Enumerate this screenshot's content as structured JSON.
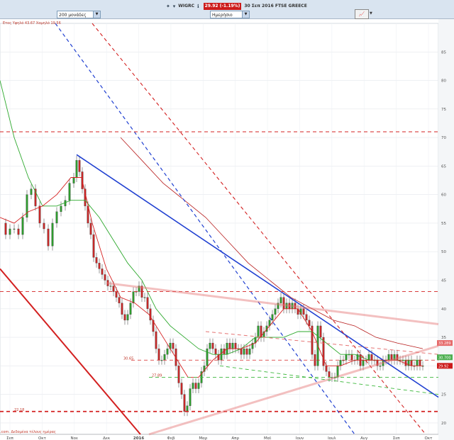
{
  "toolbar": {
    "period_selected": "200 μονάδες",
    "interval_selected": "Ημερήσιο",
    "ticker": "WIGRC",
    "price": "29.92 (-1.19%)",
    "chart_title": "30 Σεπ 2016 FTSE GREECE",
    "icons": [
      "info-icon",
      "chart-type-icon"
    ]
  },
  "annotations": {
    "hilo": "Ετος Υψηλό 43.67 Χαμηλό 19.56",
    "footnote": ".com. Δεδομένα τέλους ημέρας",
    "level_a": "30.65",
    "level_b": "27.89",
    "level_c": "22.18",
    "value_a": "33.289",
    "value_b": "30.700",
    "value_c": "29.92"
  },
  "chart_data": {
    "type": "candlestick",
    "title": "30 Σεπ 2016 FTSE GREECE",
    "ylim": [
      18,
      90
    ],
    "yticks": [
      20,
      25,
      30,
      35,
      40,
      45,
      50,
      55,
      60,
      65,
      70,
      75,
      80,
      85
    ],
    "xticks": [
      "Σεπ",
      "Οκτ",
      "Νοε",
      "Δεκ",
      "2016",
      "Φεβ",
      "Μαρ",
      "Απρ",
      "Μαϊ",
      "Ιουν",
      "Ιουλ",
      "Αυγ",
      "Σεπ",
      "Οκτ"
    ],
    "grid": true,
    "price_path": [
      [
        0,
        55
      ],
      [
        8,
        53
      ],
      [
        14,
        54
      ],
      [
        20,
        54
      ],
      [
        26,
        53
      ],
      [
        32,
        56
      ],
      [
        38,
        60
      ],
      [
        44,
        61
      ],
      [
        50,
        58
      ],
      [
        56,
        55
      ],
      [
        62,
        54
      ],
      [
        68,
        51
      ],
      [
        74,
        55
      ],
      [
        80,
        57
      ],
      [
        86,
        58
      ],
      [
        92,
        59
      ],
      [
        98,
        62
      ],
      [
        104,
        63
      ],
      [
        108,
        66
      ],
      [
        112,
        64
      ],
      [
        116,
        61
      ],
      [
        120,
        58
      ],
      [
        124,
        55
      ],
      [
        128,
        53
      ],
      [
        132,
        49
      ],
      [
        136,
        48
      ],
      [
        140,
        47
      ],
      [
        144,
        46
      ],
      [
        148,
        45
      ],
      [
        152,
        44
      ],
      [
        156,
        44
      ],
      [
        160,
        43
      ],
      [
        164,
        42
      ],
      [
        168,
        41
      ],
      [
        172,
        39
      ],
      [
        176,
        38
      ],
      [
        180,
        39
      ],
      [
        184,
        41
      ],
      [
        188,
        43
      ],
      [
        192,
        43
      ],
      [
        196,
        44
      ],
      [
        200,
        42
      ],
      [
        204,
        42
      ],
      [
        208,
        40
      ],
      [
        212,
        38
      ],
      [
        216,
        36
      ],
      [
        220,
        33
      ],
      [
        224,
        31
      ],
      [
        228,
        31
      ],
      [
        232,
        32
      ],
      [
        236,
        33
      ],
      [
        240,
        34
      ],
      [
        244,
        33
      ],
      [
        248,
        30
      ],
      [
        252,
        27
      ],
      [
        256,
        25
      ],
      [
        260,
        22
      ],
      [
        264,
        23
      ],
      [
        268,
        26
      ],
      [
        272,
        27
      ],
      [
        276,
        26
      ],
      [
        280,
        27
      ],
      [
        284,
        29
      ],
      [
        288,
        30
      ],
      [
        292,
        33
      ],
      [
        296,
        34
      ],
      [
        300,
        33
      ],
      [
        304,
        32
      ],
      [
        308,
        31
      ],
      [
        312,
        33
      ],
      [
        316,
        32
      ],
      [
        320,
        34
      ],
      [
        324,
        33
      ],
      [
        328,
        34
      ],
      [
        332,
        33
      ],
      [
        336,
        33
      ],
      [
        340,
        32
      ],
      [
        344,
        33
      ],
      [
        348,
        32
      ],
      [
        352,
        33
      ],
      [
        356,
        34
      ],
      [
        360,
        35
      ],
      [
        364,
        37
      ],
      [
        368,
        35
      ],
      [
        372,
        36
      ],
      [
        376,
        37
      ],
      [
        380,
        38
      ],
      [
        384,
        39
      ],
      [
        388,
        40
      ],
      [
        392,
        41
      ],
      [
        396,
        42
      ],
      [
        400,
        40
      ],
      [
        404,
        41
      ],
      [
        408,
        40
      ],
      [
        412,
        41
      ],
      [
        416,
        40
      ],
      [
        420,
        39
      ],
      [
        424,
        40
      ],
      [
        428,
        39
      ],
      [
        432,
        38
      ],
      [
        436,
        37
      ],
      [
        440,
        32
      ],
      [
        444,
        30
      ],
      [
        448,
        37
      ],
      [
        452,
        35
      ],
      [
        456,
        30
      ],
      [
        460,
        29
      ],
      [
        464,
        28
      ],
      [
        468,
        28
      ],
      [
        472,
        28
      ],
      [
        476,
        30
      ],
      [
        480,
        31
      ],
      [
        484,
        31
      ],
      [
        488,
        32
      ],
      [
        492,
        32
      ],
      [
        496,
        31
      ],
      [
        500,
        31
      ],
      [
        504,
        32
      ],
      [
        508,
        30
      ],
      [
        512,
        31
      ],
      [
        516,
        31
      ],
      [
        520,
        32
      ],
      [
        524,
        31
      ],
      [
        528,
        31
      ],
      [
        532,
        30
      ],
      [
        536,
        30
      ],
      [
        540,
        31
      ],
      [
        544,
        31
      ],
      [
        548,
        32
      ],
      [
        552,
        31
      ],
      [
        556,
        32
      ],
      [
        560,
        31
      ],
      [
        564,
        31
      ],
      [
        568,
        31
      ],
      [
        572,
        30
      ],
      [
        576,
        31
      ],
      [
        580,
        30
      ],
      [
        584,
        30
      ],
      [
        588,
        31
      ],
      [
        592,
        30
      ],
      [
        596,
        30
      ]
    ],
    "lines": [
      {
        "name": "",
        "color": "#1f3fd1",
        "dash": false,
        "width": 1.6,
        "points": [
          [
            108,
            67
          ],
          [
            618,
            24.5
          ]
        ]
      },
      {
        "name": "",
        "color": "#1f3fd1",
        "dash": true,
        "width": 1.2,
        "points": [
          [
            78,
            90
          ],
          [
            500,
            18
          ]
        ]
      },
      {
        "name": "",
        "color": "#d32020",
        "dash": true,
        "width": 1.1,
        "points": [
          [
            130,
            90
          ],
          [
            600,
            18
          ]
        ]
      },
      {
        "name": "",
        "color": "#d32020",
        "dash": false,
        "width": 2,
        "points": [
          [
            0,
            47
          ],
          [
            198,
            18
          ]
        ]
      },
      {
        "name": "",
        "color": "#d32020",
        "dash": true,
        "width": 1,
        "points": [
          [
            0,
            71
          ],
          [
            618,
            71
          ]
        ]
      },
      {
        "name": "",
        "color": "#d32020",
        "dash": true,
        "width": 0.9,
        "points": [
          [
            0,
            43
          ],
          [
            618,
            43
          ]
        ]
      },
      {
        "name": "",
        "color": "#d32020",
        "dash": true,
        "width": 1.8,
        "points": [
          [
            0,
            22
          ],
          [
            618,
            22
          ]
        ]
      },
      {
        "name": "",
        "color": "#d32020",
        "dash": true,
        "width": 0.7,
        "points": [
          [
            185,
            31
          ],
          [
            618,
            31
          ]
        ]
      },
      {
        "name": "",
        "color": "#e57373",
        "dash": false,
        "width": 3,
        "points": [
          [
            150,
            44.5
          ],
          [
            618,
            37.3
          ]
        ]
      },
      {
        "name": "",
        "color": "#e57373",
        "dash": false,
        "width": 3,
        "points": [
          [
            210,
            18
          ],
          [
            618,
            33.5
          ]
        ]
      },
      {
        "name": "",
        "color": "#e57373",
        "dash": true,
        "width": 1,
        "points": [
          [
            290,
            36
          ],
          [
            618,
            32
          ]
        ]
      },
      {
        "name": "",
        "color": "#3cb83c",
        "dash": true,
        "width": 0.9,
        "points": [
          [
            210,
            28
          ],
          [
            618,
            28
          ]
        ]
      },
      {
        "name": "",
        "color": "#3cb83c",
        "dash": true,
        "width": 0.9,
        "points": [
          [
            310,
            30
          ],
          [
            618,
            25
          ]
        ]
      }
    ],
    "ma_red": [
      [
        0,
        56
      ],
      [
        20,
        55
      ],
      [
        40,
        57
      ],
      [
        60,
        58
      ],
      [
        80,
        60
      ],
      [
        100,
        63
      ],
      [
        115,
        63
      ],
      [
        130,
        55
      ],
      [
        150,
        47
      ],
      [
        170,
        42
      ],
      [
        190,
        41
      ],
      [
        210,
        39
      ],
      [
        230,
        35
      ],
      [
        250,
        31
      ],
      [
        265,
        28
      ],
      [
        280,
        28
      ],
      [
        300,
        31
      ],
      [
        320,
        33
      ],
      [
        340,
        33
      ],
      [
        360,
        34
      ],
      [
        380,
        37
      ],
      [
        400,
        40
      ],
      [
        420,
        40
      ],
      [
        440,
        36
      ],
      [
        460,
        30
      ],
      [
        480,
        30
      ],
      [
        500,
        31
      ],
      [
        520,
        31
      ],
      [
        540,
        31
      ],
      [
        560,
        31
      ],
      [
        580,
        30
      ],
      [
        596,
        30
      ]
    ],
    "ma_green": [
      [
        0,
        80
      ],
      [
        20,
        70
      ],
      [
        40,
        63
      ],
      [
        60,
        58
      ],
      [
        80,
        58
      ],
      [
        100,
        59
      ],
      [
        120,
        59
      ],
      [
        140,
        56
      ],
      [
        160,
        52
      ],
      [
        180,
        48
      ],
      [
        200,
        45
      ],
      [
        220,
        40
      ],
      [
        240,
        37
      ],
      [
        260,
        35
      ],
      [
        280,
        33
      ],
      [
        300,
        32
      ],
      [
        320,
        32
      ],
      [
        340,
        33
      ],
      [
        360,
        35
      ],
      [
        380,
        35
      ],
      [
        400,
        35
      ],
      [
        420,
        36
      ],
      [
        440,
        36
      ],
      [
        460,
        34
      ],
      [
        480,
        32
      ],
      [
        500,
        32
      ],
      [
        520,
        31
      ],
      [
        540,
        31
      ],
      [
        560,
        31
      ],
      [
        580,
        31
      ],
      [
        596,
        31
      ]
    ],
    "ma_darkred": [
      [
        170,
        70
      ],
      [
        200,
        66
      ],
      [
        230,
        62
      ],
      [
        260,
        59
      ],
      [
        290,
        56
      ],
      [
        320,
        52
      ],
      [
        350,
        48
      ],
      [
        380,
        45
      ],
      [
        410,
        42
      ],
      [
        440,
        40
      ],
      [
        470,
        38
      ],
      [
        500,
        37
      ],
      [
        530,
        35
      ],
      [
        560,
        34
      ],
      [
        596,
        33
      ]
    ]
  }
}
